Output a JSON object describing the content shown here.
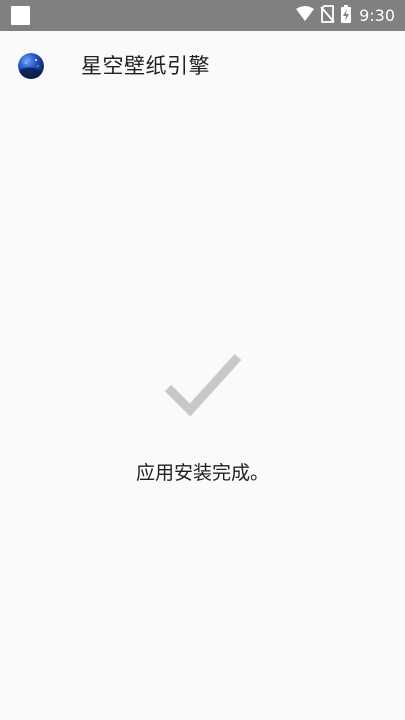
{
  "status_bar": {
    "time": "9:30",
    "icons": [
      "notification-square-icon",
      "wifi-icon",
      "no-sim-icon",
      "battery-charging-icon"
    ]
  },
  "app_bar": {
    "app_icon": "starry-sky-app-icon",
    "title": "星空壁纸引擎"
  },
  "main": {
    "status_icon": "checkmark-icon",
    "message": "应用安装完成。"
  },
  "colors": {
    "status_bar_bg": "#808080",
    "page_bg": "#fafafa",
    "checkmark": "#c8c8c8",
    "text": "#212121"
  }
}
